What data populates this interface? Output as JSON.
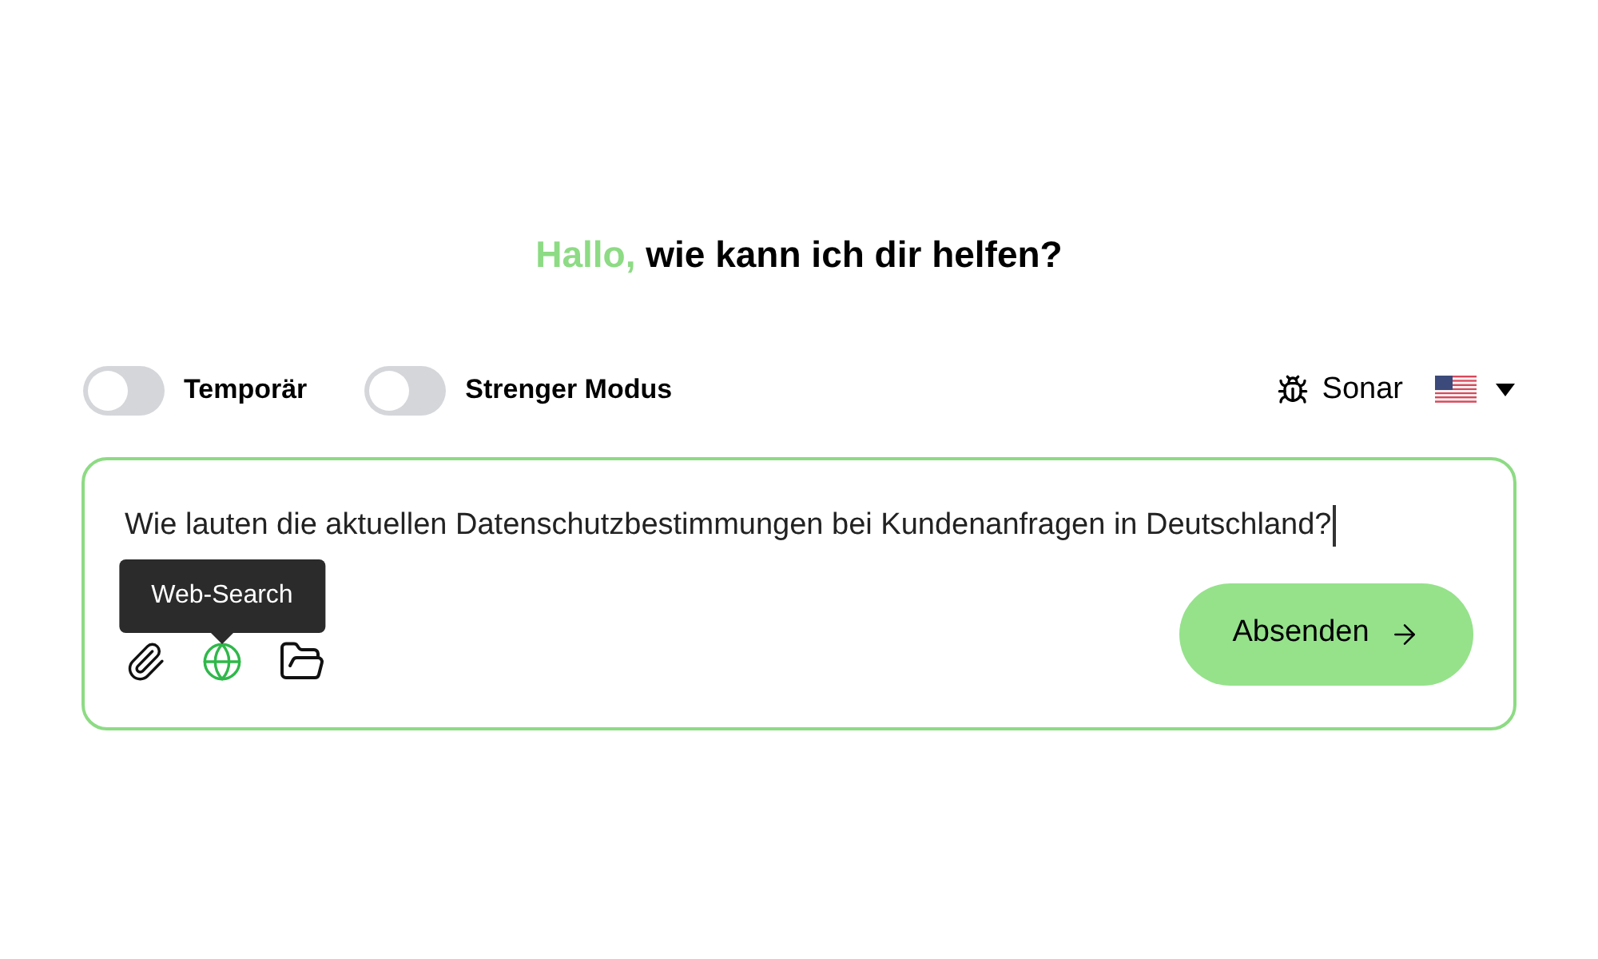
{
  "greeting": {
    "highlight": "Hallo,",
    "rest": "wie kann ich dir helfen?"
  },
  "toggles": [
    {
      "label": "Temporär",
      "on": false
    },
    {
      "label": "Strenger Modus",
      "on": false
    }
  ],
  "model": {
    "name": "Sonar"
  },
  "prompt": {
    "value": "Wie lauten die aktuellen Datenschutzbestimmungen bei Kundenanfragen in Deutschland?"
  },
  "tools": [
    {
      "kind": "attach",
      "active": false
    },
    {
      "kind": "web",
      "active": true,
      "tooltip": "Web-Search"
    },
    {
      "kind": "folder",
      "active": false
    }
  ],
  "submit": {
    "label": "Absenden"
  }
}
